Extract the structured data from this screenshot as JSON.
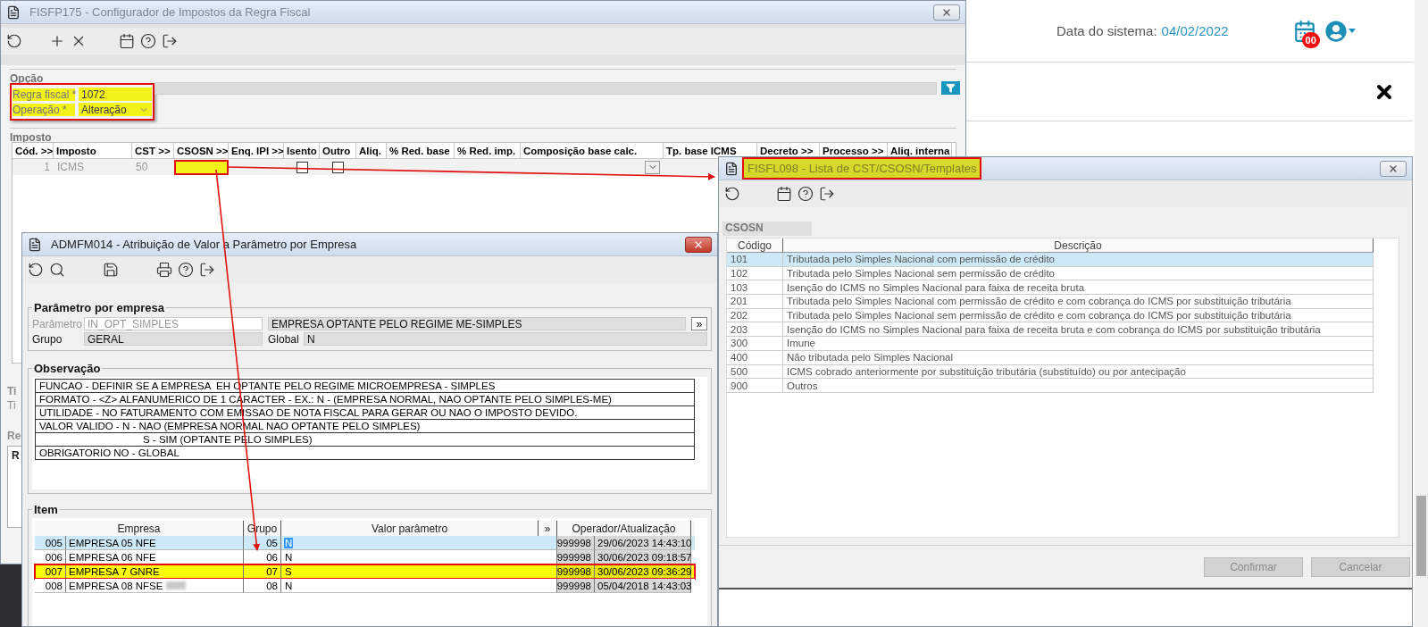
{
  "main_window": {
    "title": "FISFP175 - Configurador de Impostos da Regra Fiscal",
    "active": false,
    "option_section": {
      "title": "Opção",
      "highlighted": true,
      "fields": [
        {
          "label": "Regra fiscal *",
          "value": "1072",
          "kind": "text"
        },
        {
          "label": "Operação *",
          "value": "Alteração",
          "kind": "select"
        }
      ]
    },
    "tax_section": {
      "title": "Imposto",
      "columns": [
        "Cód. >>",
        "Imposto",
        "CST >>",
        "CSOSN >>",
        "Enq. IPI >>",
        "Isento",
        "Outro",
        "Aliq.",
        "% Red. base",
        "% Red. imp.",
        "Composição base calc.",
        "Tp. base ICMS",
        "Decreto >>",
        "Processo  >>",
        "Aliq. interna"
      ],
      "rows": [
        {
          "code": "1",
          "tax": "ICMS",
          "cst": "50",
          "csosn_highlighted": true,
          "exempt": false,
          "other": false
        }
      ]
    },
    "covered_labels": [
      {
        "text": "Ti",
        "kind": "heading"
      },
      {
        "text": "Ti",
        "kind": "hint"
      },
      {
        "text": "Re",
        "kind": "heading"
      },
      {
        "text": "R",
        "kind": "column"
      }
    ]
  },
  "system_bar": {
    "label": "Data do sistema:",
    "date": "04/02/2022",
    "notification_count": "00"
  },
  "list_window": {
    "title": "FISFL098 - Lista de CST/CSOSN/Templates",
    "active": false,
    "highlighted": true,
    "group": "CSOSN",
    "columns": [
      "Código",
      "Descrição"
    ],
    "rows": [
      {
        "code": "101",
        "description": "Tributada pelo Simples Nacional com permissão de crédito",
        "selected": true
      },
      {
        "code": "102",
        "description": "Tributada pelo Simples Nacional sem permissão de crédito",
        "selected": false
      },
      {
        "code": "103",
        "description": "Isenção do ICMS no Simples Nacional para faixa de receita bruta",
        "selected": false
      },
      {
        "code": "201",
        "description": "Tributada pelo Simples Nacional com permissão de crédito e com cobrança do ICMS por substituição tributária",
        "selected": false
      },
      {
        "code": "202",
        "description": "Tributada pelo Simples Nacional sem permissão de crédito e com cobrança do ICMS por substituição tributária",
        "selected": false
      },
      {
        "code": "203",
        "description": "Isenção do ICMS no Simples Nacional para faixa de receita bruta e com cobrança do ICMS por substituição tributária",
        "selected": false
      },
      {
        "code": "300",
        "description": "Imune",
        "selected": false
      },
      {
        "code": "400",
        "description": "Não tributada pelo Simples Nacional",
        "selected": false
      },
      {
        "code": "500",
        "description": "ICMS cobrado anteriormente por substituição tributária (substituído) ou por antecipação",
        "selected": false
      },
      {
        "code": "900",
        "description": "Outros",
        "selected": false
      }
    ],
    "buttons": [
      {
        "label": "Confirmar",
        "disabled": true
      },
      {
        "label": "Cancelar",
        "disabled": true
      }
    ]
  },
  "param_window": {
    "title": "ADMFM014 - Atribuição de Valor a Parâmetro por Empresa",
    "active": true,
    "param_group": {
      "title": "Parâmetro por empresa",
      "parameter_label": "Parâmetro",
      "parameter": "IN_OPT_SIMPLES",
      "description": "EMPRESA OPTANTE PELO REGIME ME-SIMPLES",
      "more_button": "»",
      "group_label": "Grupo",
      "group": "GERAL",
      "global_label": "Global",
      "global": "N"
    },
    "notes": {
      "title": "Observação",
      "lines": [
        {
          "text": "FUNCAO - DEFINIR SE A EMPRESA  EH OPTANTE PELO REGIME MICROEMPRESA - SIMPLES",
          "kind": "line"
        },
        {
          "text": "FORMATO - <Z> ALFANUMERICO DE 1 CARACTER - EX.: N - (EMPRESA NORMAL, NAO OPTANTE PELO SIMPLES-ME)",
          "kind": "line"
        },
        {
          "text": "UTILIDADE - NO FATURAMENTO COM EMISSAO DE NOTA FISCAL PARA GERAR OU NAO O IMPOSTO DEVIDO.",
          "kind": "line"
        },
        {
          "text": "VALOR VALIDO - N - NAO (EMPRESA NORMAL NAO OPTANTE PELO SIMPLES)",
          "kind": "line"
        },
        {
          "text": "S - SIM (OPTANTE PELO SIMPLES)",
          "kind": "continuation"
        },
        {
          "text": "OBRIGATORIO NO - GLOBAL",
          "kind": "line"
        }
      ]
    },
    "items": {
      "title": "Item",
      "columns": [
        "Empresa",
        "Grupo",
        "Valor parâmetro",
        "»",
        "Operador/Atualização"
      ],
      "rows": [
        {
          "code": "005",
          "company": "EMPRESA 05 NFE",
          "group": "05",
          "value": "N",
          "operator": "999998",
          "updated": "29/06/2023 14:43:10",
          "selected": true,
          "highlighted": false,
          "redacted": false
        },
        {
          "code": "006",
          "company": "EMPRESA 06 NFE",
          "group": "06",
          "value": "N",
          "operator": "999998",
          "updated": "30/06/2023 09:18:57",
          "selected": false,
          "highlighted": false,
          "redacted": false
        },
        {
          "code": "007",
          "company": "EMPRESA 7 GNRE",
          "group": "07",
          "value": "S",
          "operator": "999998",
          "updated": "30/06/2023 09:36:29",
          "selected": false,
          "highlighted": true,
          "redacted": false
        },
        {
          "code": "008",
          "company": "EMPRESA 08 NFSE",
          "group": "08",
          "value": "N",
          "operator": "999998",
          "updated": "05/04/2018 14:43:03",
          "selected": false,
          "highlighted": false,
          "redacted": true
        }
      ]
    }
  }
}
